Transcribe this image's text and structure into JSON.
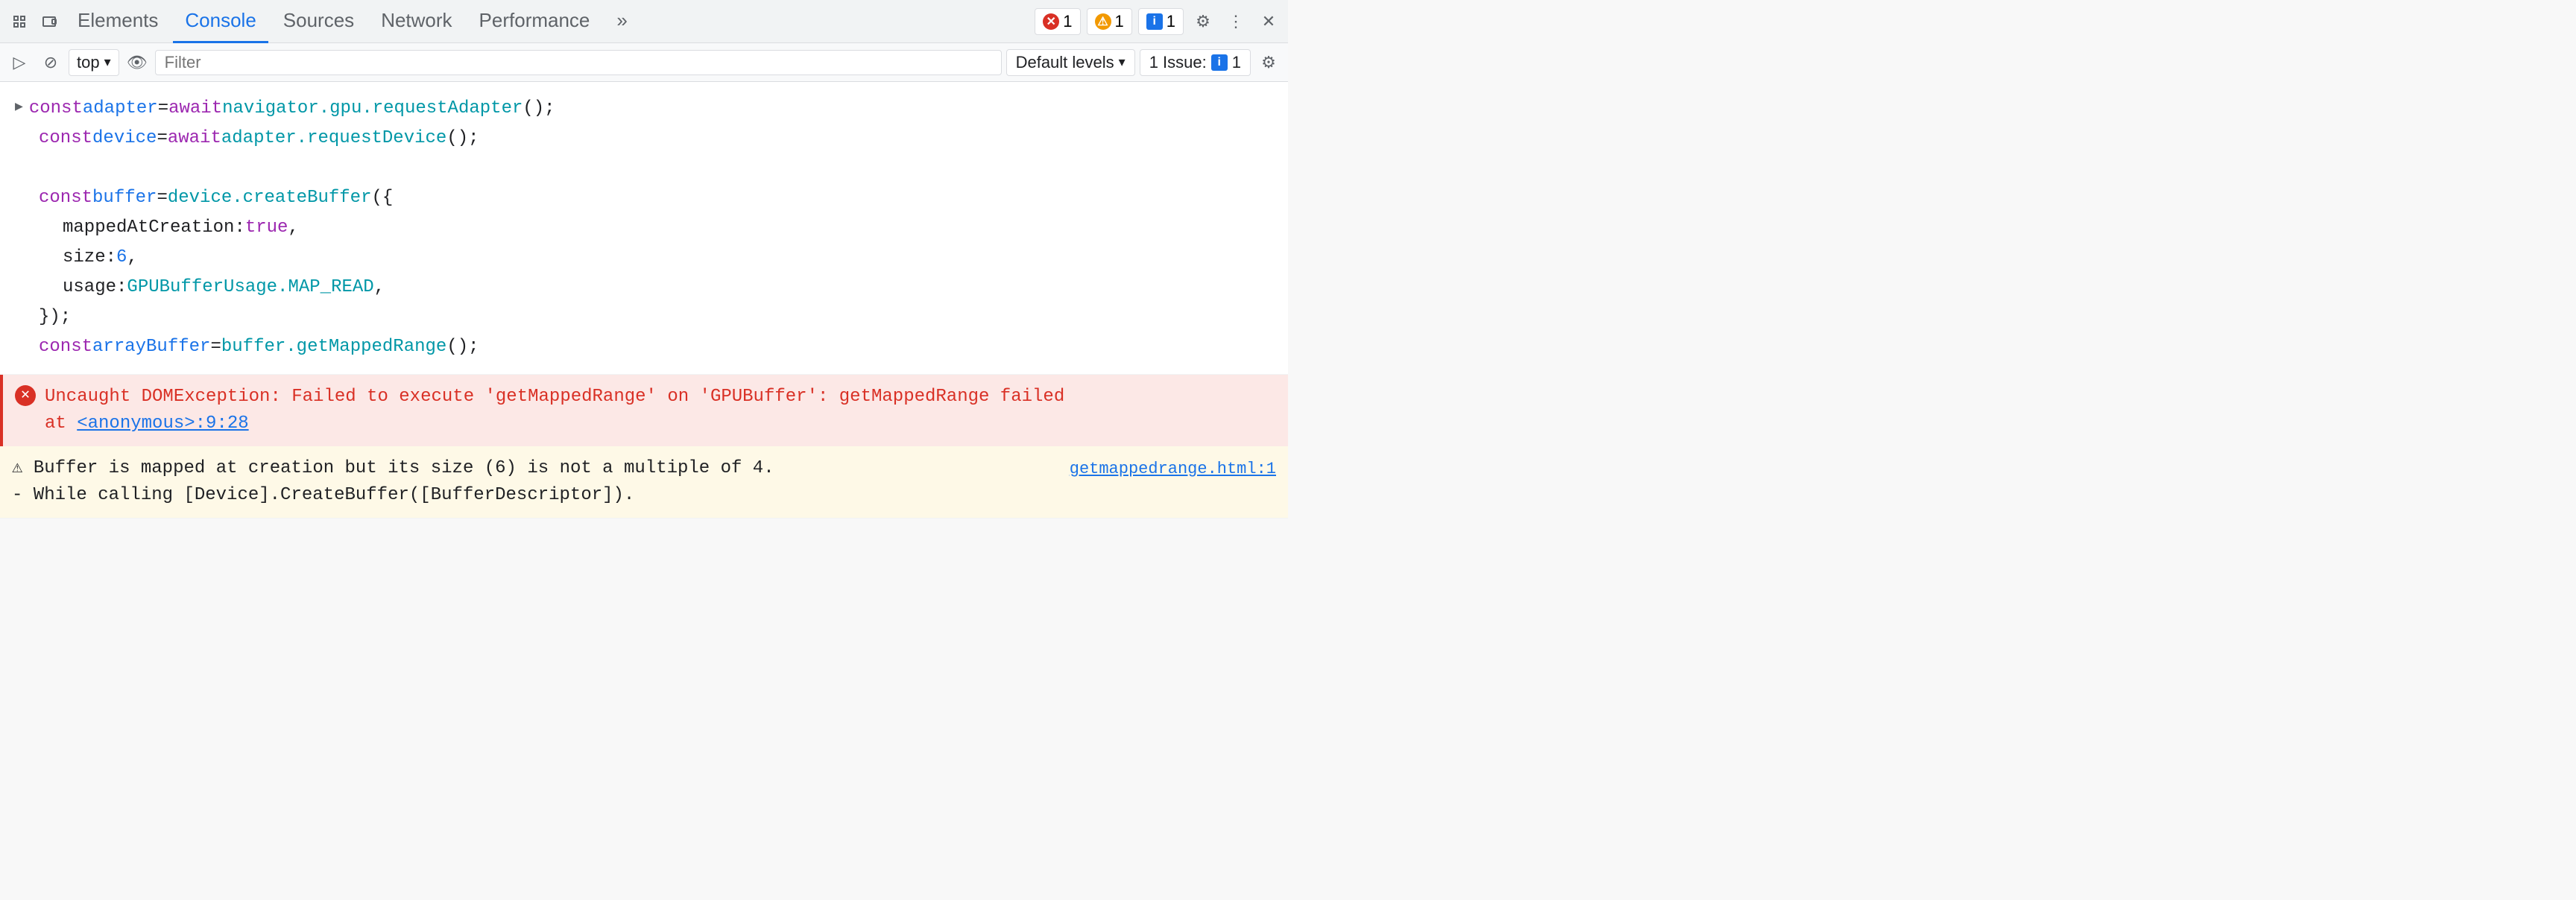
{
  "tabs": {
    "inspect_icon": "⊹",
    "device_icon": "▭",
    "items": [
      {
        "label": "Elements",
        "active": false
      },
      {
        "label": "Console",
        "active": true
      },
      {
        "label": "Sources",
        "active": false
      },
      {
        "label": "Network",
        "active": false
      },
      {
        "label": "Performance",
        "active": false
      },
      {
        "label": "»",
        "active": false
      }
    ]
  },
  "badges": {
    "error_count": "1",
    "warning_count": "1",
    "info_count": "1"
  },
  "secondary": {
    "sidebar_icon": "▷",
    "block_icon": "⊘",
    "top_label": "top",
    "dropdown_arrow": "▾",
    "eye_icon": "👁",
    "filter_placeholder": "Filter",
    "default_levels_label": "Default levels",
    "issues_label": "1 Issue:",
    "issues_count": "1",
    "gear_icon": "⚙"
  },
  "code": {
    "line1_kw": "const",
    "line1_var": " adapter",
    "line1_eq": " =",
    "line1_kw2": " await",
    "line1_val": " navigator.gpu.requestAdapter",
    "line1_end": "();",
    "line2_kw": "const",
    "line2_var": " device",
    "line2_eq": " =",
    "line2_kw2": " await",
    "line2_val": " adapter.requestDevice",
    "line2_end": "();",
    "line3": "",
    "line4_kw": "const",
    "line4_var": " buffer",
    "line4_eq": " =",
    "line4_val": " device.createBuffer",
    "line4_end": "({",
    "line5_prop": "  mappedAtCreation:",
    "line5_val": " true",
    "line5_end": ",",
    "line6_prop": "  size:",
    "line6_val": " 6",
    "line6_end": ",",
    "line7_prop": "  usage:",
    "line7_val": " GPUBufferUsage.MAP_READ",
    "line7_end": ",",
    "line8_end": "});",
    "line9_kw": "const",
    "line9_var": " arrayBuffer",
    "line9_eq": " =",
    "line9_val": " buffer.getMappedRange",
    "line9_end": "();"
  },
  "error": {
    "text": "Uncaught DOMException: Failed to execute 'getMappedRange' on 'GPUBuffer': getMappedRange failed",
    "at_text": "    at <anonymous>:9:28"
  },
  "warning": {
    "text1": "⚠ Buffer is mapped at creation but its size (6) is not a multiple of 4.",
    "text2": "  - While calling [Device].CreateBuffer([BufferDescriptor]).",
    "link": "getmappedrange.html:1"
  }
}
